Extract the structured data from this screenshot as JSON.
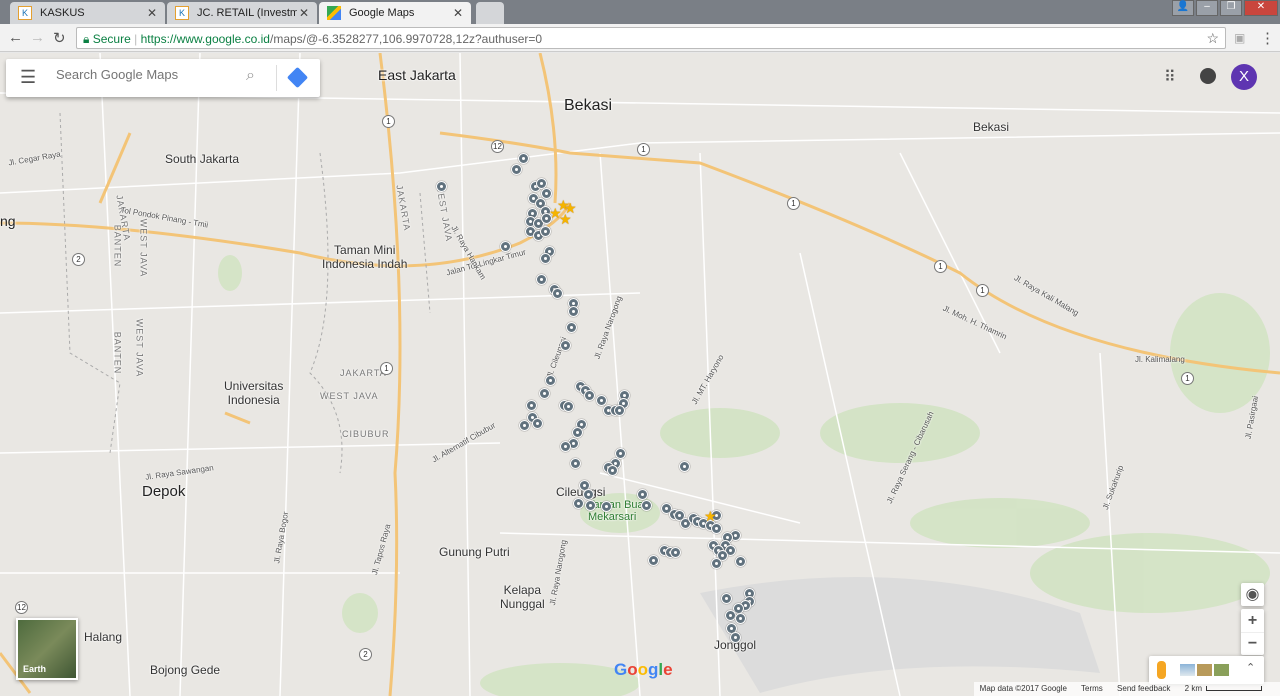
{
  "browser": {
    "tabs": [
      {
        "label": "KASKUS",
        "icon": "kaskus-icon"
      },
      {
        "label": "JC. RETAIL (Investment P",
        "icon": "kaskus-icon"
      },
      {
        "label": "Google Maps",
        "icon": "google-maps-icon"
      }
    ],
    "secure_label": "Secure",
    "url_host": "https://www.google.co.id",
    "url_path": "/maps/@-6.3528277,106.9970728,12z?authuser=0"
  },
  "search": {
    "placeholder": "Search Google Maps"
  },
  "account": {
    "initial": "X",
    "color": "#5e35b1"
  },
  "map": {
    "labels": {
      "east_jakarta": "East Jakarta",
      "bekasi_city": "Bekasi",
      "bekasi_regency": "Bekasi",
      "south_jakarta": "South Jakarta",
      "taman_mini": "Taman Mini\nIndonesia Indah",
      "ui": "Universitas\nIndonesia",
      "depok": "Depok",
      "cileungsi": "Cileungsi",
      "mekarsari": "Taman Buah\nMekarsari",
      "gunung_putri": "Gunung Putri",
      "kelapa_nunggal": "Kelapa\nNunggal",
      "halang": "Halang",
      "bojong_gede": "Bojong Gede",
      "jonggol": "Jonggol",
      "cibubur": "CIBUBUR",
      "jakarta1": "JAKARTA",
      "westjava1": "WEST JAVA",
      "jakarta2": "JAKARTA",
      "westjava2": "WEST JAVA",
      "banten": "BANTEN",
      "westjava3": "WEST JAVA",
      "westjava4": "WEST JAVA",
      "jakarta3": "JAKARTA",
      "banten2": "BANTEN",
      "toll_lingkar": "Jalan Tol Lingkar Timur",
      "toll_pinang": "Tol Pondok Pinang - Tmii",
      "jl_kalimalang": "Jl. Kalimalang",
      "jl_thamrin": "Jl. Moh. H. Thamrin",
      "jl_kalimalang2": "Jl. Raya Kali Malang",
      "jl_narogong": "Jl. Raya Narogong",
      "jl_alternatif": "Jl. Alternatif Cibubur",
      "jl_hankam": "Jl. Raya Hankam",
      "jl_bogor": "Jl. Raya Bogor",
      "jl_cagak": "Jl. Cileungsi",
      "jl_sawangan": "Jl. Raya Sawangan",
      "jl_tapos": "Jl. Tapos Raya",
      "jl_pasirgaai": "Jl. Pasirgaai",
      "jl_cibarusah": "Jl. Raya Serang - Cibarusah",
      "jl_mthanoyo": "Jl. MT. Haryono",
      "jl_ganggeni": "Jl. Cegar Raya",
      "jl_sukahurip": "Jl. Sukahurip",
      "edge": "ng"
    },
    "road_shields": [
      "1",
      "1",
      "1",
      "1",
      "1",
      "1",
      "1",
      "2",
      "2",
      "12",
      "12"
    ],
    "earth_label": "Earth",
    "logo": "Google",
    "footer": {
      "map_data": "Map data ©2017 Google",
      "terms": "Terms",
      "feedback": "Send feedback",
      "scale": "2 km"
    }
  }
}
